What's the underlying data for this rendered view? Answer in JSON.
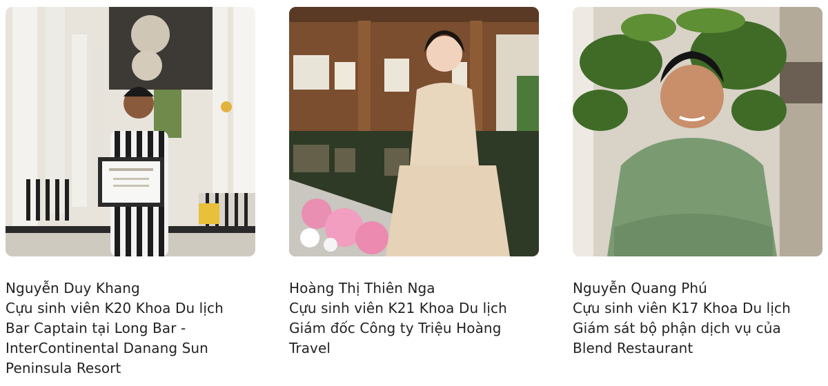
{
  "alumni": [
    {
      "photo_icon": "alumni-photo",
      "name": "Nguyễn Duy Khang",
      "cohort": "Cựu sinh viên K20 Khoa Du lịch",
      "position": "Bar Captain tại Long Bar - InterContinental Danang Sun Peninsula Resort"
    },
    {
      "photo_icon": "alumni-photo",
      "name": "Hoàng Thị Thiên Nga",
      "cohort": "Cựu sinh viên K21 Khoa Du lịch",
      "position": "Giám đốc Công ty Triệu Hoàng Travel"
    },
    {
      "photo_icon": "alumni-photo",
      "name": "Nguyễn Quang Phú",
      "cohort": "Cựu sinh viên K17 Khoa Du lịch",
      "position": "Giám sát bộ phận dịch vụ của Blend Restaurant"
    }
  ]
}
